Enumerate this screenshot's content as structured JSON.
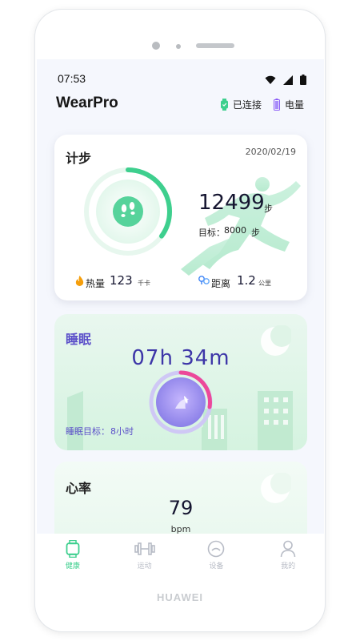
{
  "device": {
    "brand": "HUAWEI"
  },
  "status_bar": {
    "time": "07:53",
    "icons": [
      "wifi-icon",
      "signal-icon",
      "battery-icon"
    ]
  },
  "header": {
    "title": "WearPro",
    "connected_label": "已连接",
    "battery_label": "电量"
  },
  "steps": {
    "title": "计步",
    "date": "2020/02/19",
    "value": "12499",
    "unit": "步",
    "goal_label": "目标：",
    "goal_value": "8000",
    "goal_unit": "步",
    "progress": 0.35,
    "calories_label": "热量",
    "calories_value": "123",
    "calories_unit": "千卡",
    "distance_label": "距离",
    "distance_value": "1.2",
    "distance_unit": "公里"
  },
  "sleep": {
    "title": "睡眠",
    "duration": "07h 34m",
    "goal_label": "睡眠目标：",
    "goal_value": "8小时"
  },
  "heart": {
    "title": "心率",
    "value": "79",
    "unit": "bpm"
  },
  "tabs": [
    {
      "label": "健康",
      "icon": "watch-icon",
      "active": true
    },
    {
      "label": "运动",
      "icon": "dumbbell-icon",
      "active": false
    },
    {
      "label": "设备",
      "icon": "device-icon",
      "active": false
    },
    {
      "label": "我的",
      "icon": "person-icon",
      "active": false
    }
  ],
  "colors": {
    "accent": "#3ecf8e",
    "sleep": "#5b4fc9",
    "background": "#f5f7fd"
  }
}
